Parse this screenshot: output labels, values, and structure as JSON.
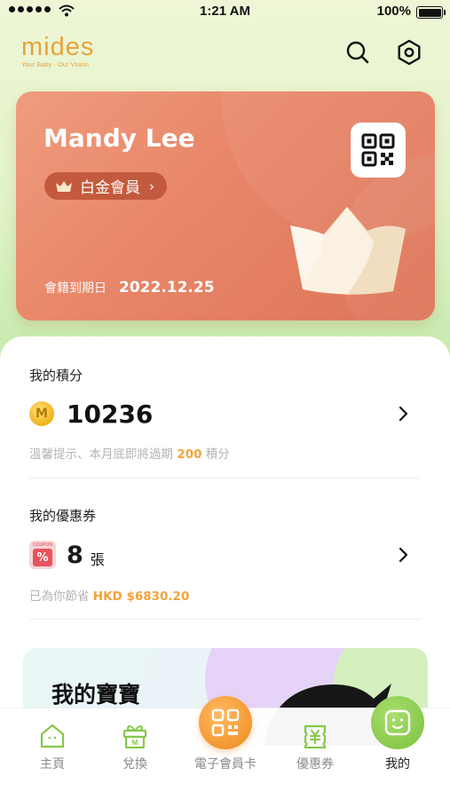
{
  "status_bar": {
    "time": "1:21 AM",
    "battery": "100%"
  },
  "brand": {
    "logo_text": "mides",
    "tagline": "Your Baby · Our Vision"
  },
  "member_card": {
    "name": "Mandy Lee",
    "tier": "白金會員",
    "expiry_label": "會籍到期日",
    "expiry_date": "2022.12.25"
  },
  "points": {
    "title": "我的積分",
    "coin_icon_letter": "M",
    "value": "10236",
    "hint_prefix": "溫馨提示、本月底即將過期",
    "hint_amount": "200",
    "hint_suffix": "積分"
  },
  "coupons": {
    "title": "我的優惠券",
    "icon_label": "COUPON",
    "icon_symbol": "%",
    "count": "8",
    "unit": "張",
    "savings_prefix": "已為你節省",
    "savings_amount": "HKD $6830.20"
  },
  "baby": {
    "title": "我的寶寶"
  },
  "tabs": [
    {
      "label": "主頁",
      "icon": "home-icon"
    },
    {
      "label": "兌換",
      "icon": "gift-icon"
    },
    {
      "label": "電子會員卡",
      "icon": "qr-code-icon"
    },
    {
      "label": "優惠券",
      "icon": "coupon-icon"
    },
    {
      "label": "我的",
      "icon": "face-icon"
    }
  ],
  "colors": {
    "accent_orange": "#f2a33a",
    "card_coral": "#e88568",
    "active_green": "#86c84a"
  }
}
